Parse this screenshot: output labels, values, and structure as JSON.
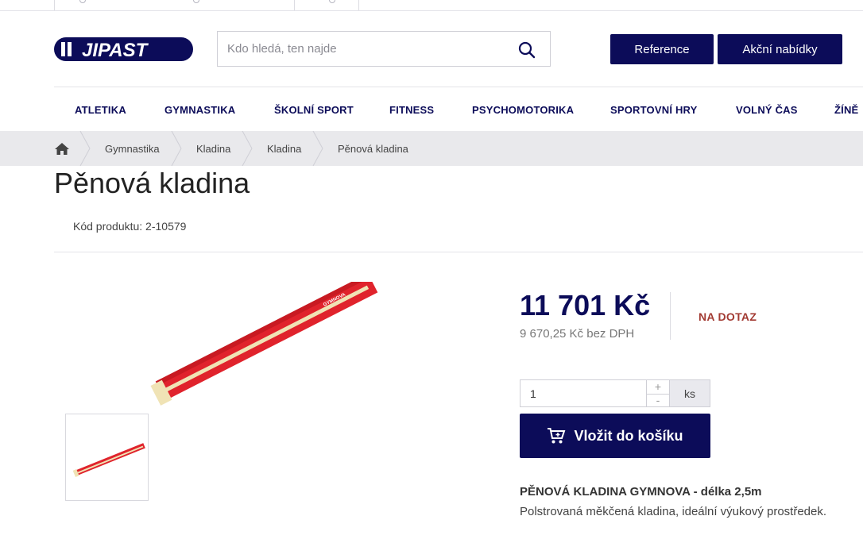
{
  "header": {
    "logo_text": "JIPAST",
    "search": {
      "placeholder": "Kdo hledá, ten najde"
    },
    "buttons": {
      "reference": "Reference",
      "offers": "Akční nabídky"
    }
  },
  "nav": {
    "items": [
      "ATLETIKA",
      "GYMNASTIKA",
      "ŠKOLNÍ SPORT",
      "FITNESS",
      "PSYCHOMOTORIKA",
      "SPORTOVNÍ HRY",
      "VOLNÝ ČAS",
      "ŽÍNĚ"
    ]
  },
  "breadcrumb": {
    "items": [
      "Gymnastika",
      "Kladina",
      "Kladina",
      "Pěnová kladina"
    ]
  },
  "product": {
    "title": "Pěnová kladina",
    "code": "Kód produktu: 2-10579",
    "image_label": "GYMNOVA",
    "price": "11 701 Kč",
    "price_no_vat": "9 670,25 Kč bez DPH",
    "availability": "NA DOTAZ",
    "quantity": "1",
    "plus": "+",
    "minus": "-",
    "unit": "ks",
    "add_to_cart": "Vložit do košíku",
    "desc_title": "PĚNOVÁ KLADINA GYMNOVA - délka 2,5m",
    "desc_text": "Polstrovaná měkčená kladina, ideální výukový prostředek."
  },
  "colors": {
    "brand_navy": "#0c0c59",
    "availability_red": "#a23a32",
    "breadcrumb_bg": "#e9e9ec",
    "beam_red": "#e0232c",
    "beam_cream": "#f0e3b5"
  },
  "icons": {
    "search": "search-icon",
    "home": "home-icon",
    "cart": "cart-icon"
  }
}
